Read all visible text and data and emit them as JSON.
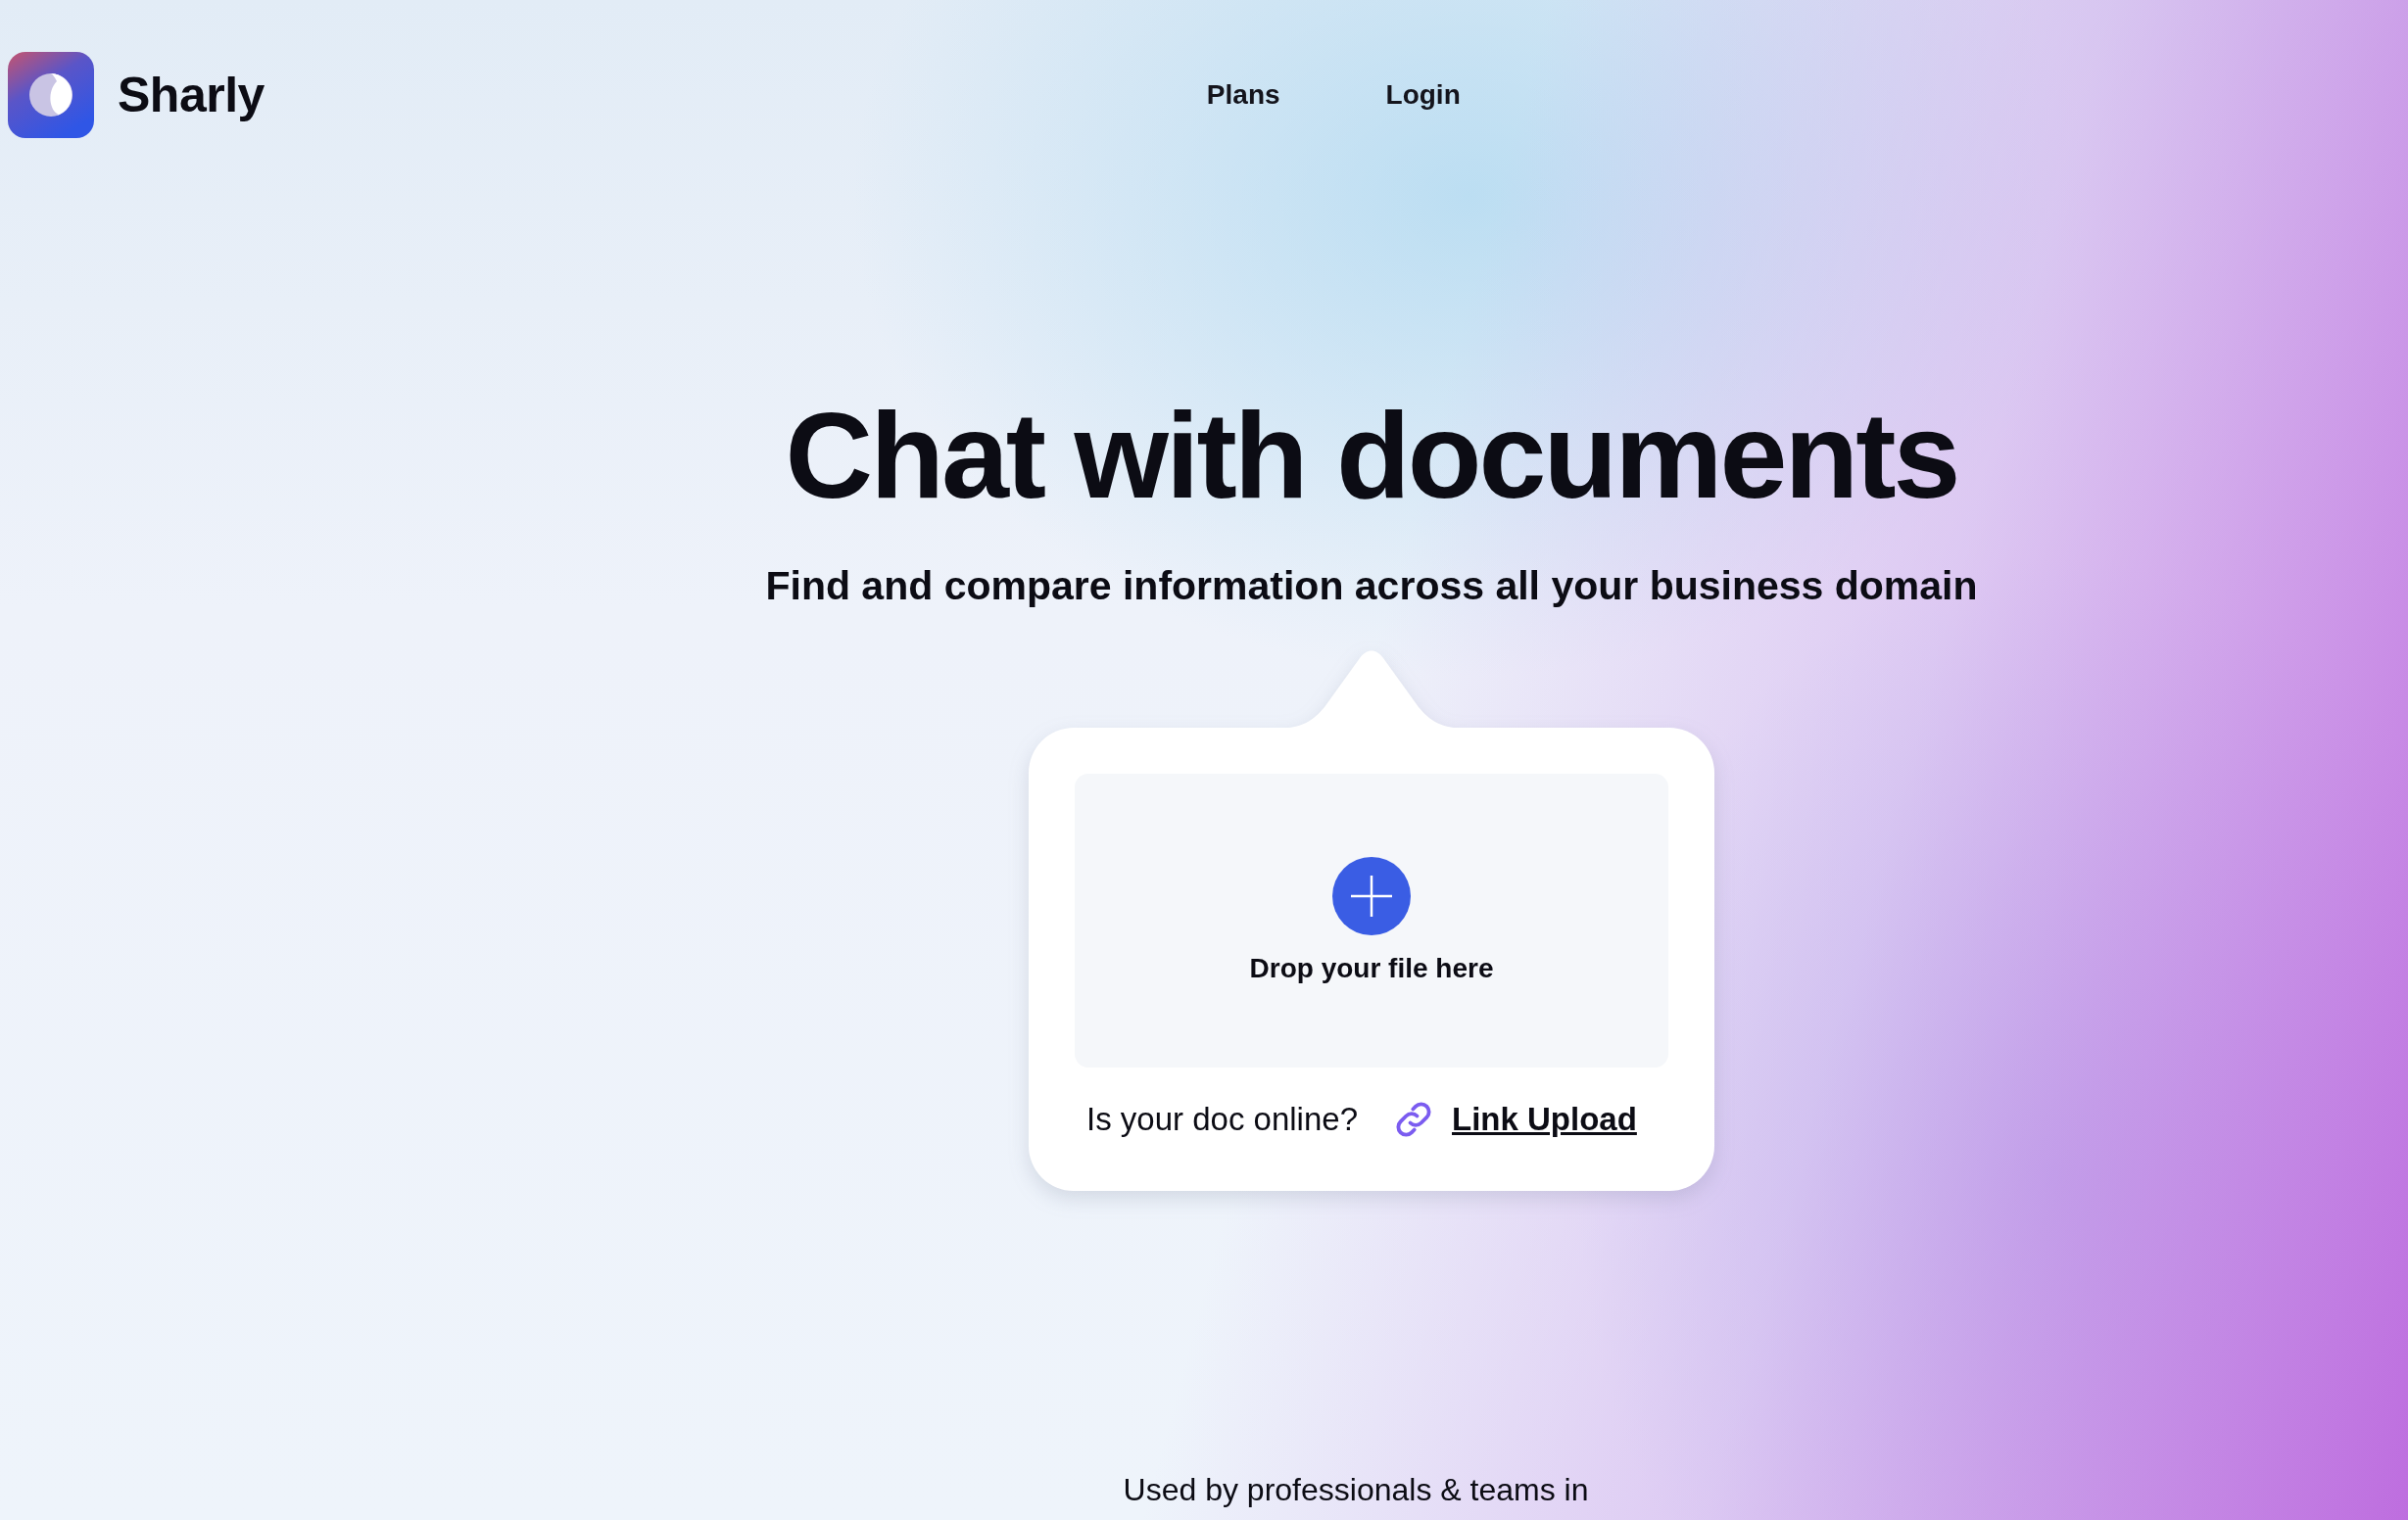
{
  "brand": {
    "name": "Sharly"
  },
  "nav": [
    {
      "label": "Plans"
    },
    {
      "label": "Login"
    }
  ],
  "hero": {
    "title": "Chat with documents",
    "subtitle": "Find and compare information across all your business domain"
  },
  "upload": {
    "drop_label": "Drop your file here",
    "online_prompt": "Is your doc online?",
    "link_label": "Link Upload"
  },
  "footer": {
    "text": "Used by professionals & teams in"
  }
}
